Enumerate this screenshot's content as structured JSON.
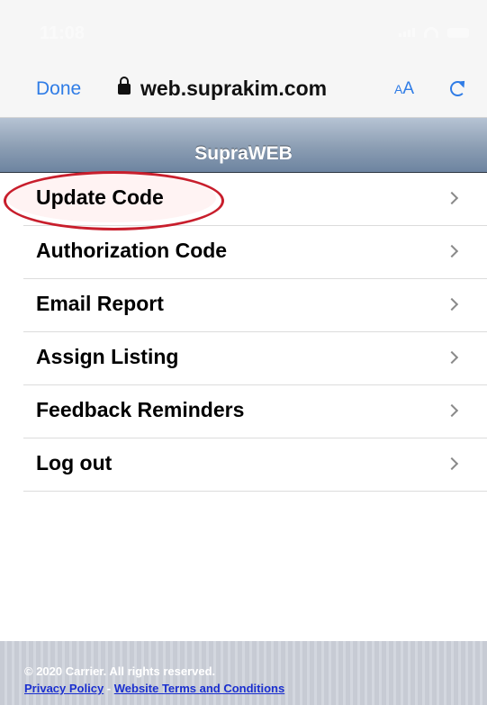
{
  "status_bar": {
    "time": "11:08"
  },
  "browser": {
    "done_label": "Done",
    "url": "web.suprakim.com",
    "aa_small": "A",
    "aa_big": "A",
    "accent": "#2f7ce6"
  },
  "header": {
    "title": "SupraWEB"
  },
  "menu": {
    "items": [
      {
        "label": "Update Code"
      },
      {
        "label": "Authorization Code"
      },
      {
        "label": "Email Report"
      },
      {
        "label": "Assign Listing"
      },
      {
        "label": "Feedback Reminders"
      },
      {
        "label": "Log out"
      }
    ],
    "highlight_color": "#c81e2c"
  },
  "footer": {
    "copyright": "© 2020 Carrier. All rights reserved.",
    "privacy_label": "Privacy Policy",
    "separator": " - ",
    "terms_label": "Website Terms and Conditions",
    "link_color": "#1a2fcf"
  }
}
